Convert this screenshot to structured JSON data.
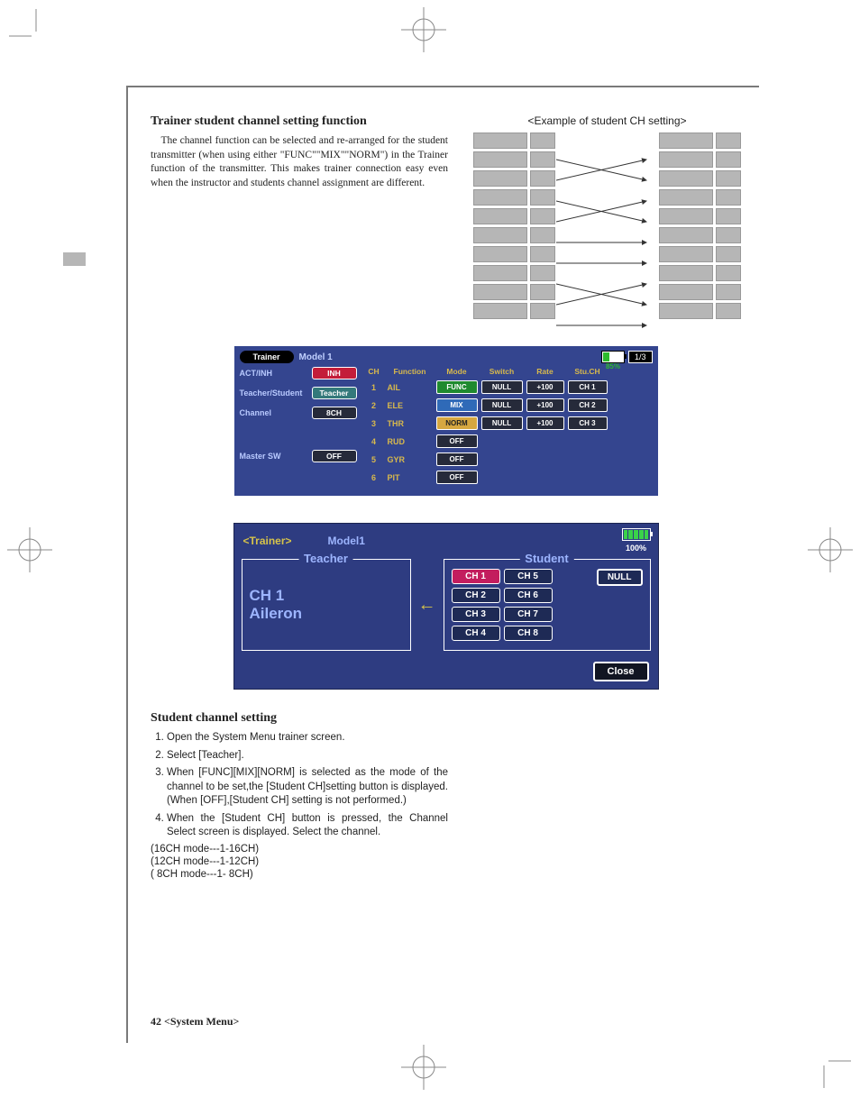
{
  "section1": {
    "title": "Trainer student channel setting function",
    "body": "The channel function can be selected and re-arranged for the student transmitter (when using either \"FUNC\"\"MIX\"\"NORM\") in the Trainer function of the transmitter. This makes trainer connection easy even when the instructor and students channel assignment are different."
  },
  "example_caption": "<Example of student CH setting>",
  "ui1": {
    "title": "Trainer",
    "model": "Model 1",
    "battery_pct": "85%",
    "page": "1/3",
    "left_rows": {
      "actinh_label": "ACT/INH",
      "actinh_value": "INH",
      "ts_label": "Teacher/Student",
      "ts_value": "Teacher",
      "channel_label": "Channel",
      "channel_value": "8CH",
      "master_label": "Master  SW",
      "master_value": "OFF"
    },
    "headers": {
      "ch": "CH",
      "func": "Function",
      "mode": "Mode",
      "sw": "Switch",
      "rate": "Rate",
      "stu": "Stu.CH"
    },
    "rows": [
      {
        "n": "1",
        "func": "AIL",
        "mode": "FUNC",
        "mode_cls": "mode-green",
        "sw": "NULL",
        "rate": "+100",
        "stu": "CH 1"
      },
      {
        "n": "2",
        "func": "ELE",
        "mode": "MIX",
        "mode_cls": "mode-blue",
        "sw": "NULL",
        "rate": "+100",
        "stu": "CH 2"
      },
      {
        "n": "3",
        "func": "THR",
        "mode": "NORM",
        "mode_cls": "mode-orange",
        "sw": "NULL",
        "rate": "+100",
        "stu": "CH 3"
      },
      {
        "n": "4",
        "func": "RUD",
        "mode": "OFF",
        "mode_cls": "mode-off"
      },
      {
        "n": "5",
        "func": "GYR",
        "mode": "OFF",
        "mode_cls": "mode-off"
      },
      {
        "n": "6",
        "func": "PIT",
        "mode": "OFF",
        "mode_cls": "mode-off"
      }
    ]
  },
  "ui2": {
    "title": "<Trainer>",
    "model": "Model1",
    "battery_pct": "100%",
    "teacher_legend": "Teacher",
    "student_legend": "Student",
    "teacher_ch": "CH 1",
    "teacher_func": "Aileron",
    "student_channels": [
      "CH 1",
      "CH 5",
      "CH 2",
      "CH 6",
      "CH 3",
      "CH 7",
      "CH 4",
      "CH 8"
    ],
    "null_label": "NULL",
    "close_label": "Close"
  },
  "section2": {
    "title": "Student channel setting",
    "steps": [
      "Open the System Menu trainer screen.",
      "Select [Teacher].",
      "When [FUNC][MIX][NORM] is selected as the mode of the channel to be set,the [Student CH]setting button is displayed. (When [OFF],[Student CH] setting is not performed.)",
      "When the [Student CH] button is pressed, the Channel Select screen is displayed. Select the channel."
    ],
    "notes": [
      "(16CH mode---1-16CH)",
      "(12CH mode---1-12CH)",
      "( 8CH mode---1-  8CH)"
    ]
  },
  "footer": {
    "page": "42",
    "crumb": "<System Menu>"
  }
}
